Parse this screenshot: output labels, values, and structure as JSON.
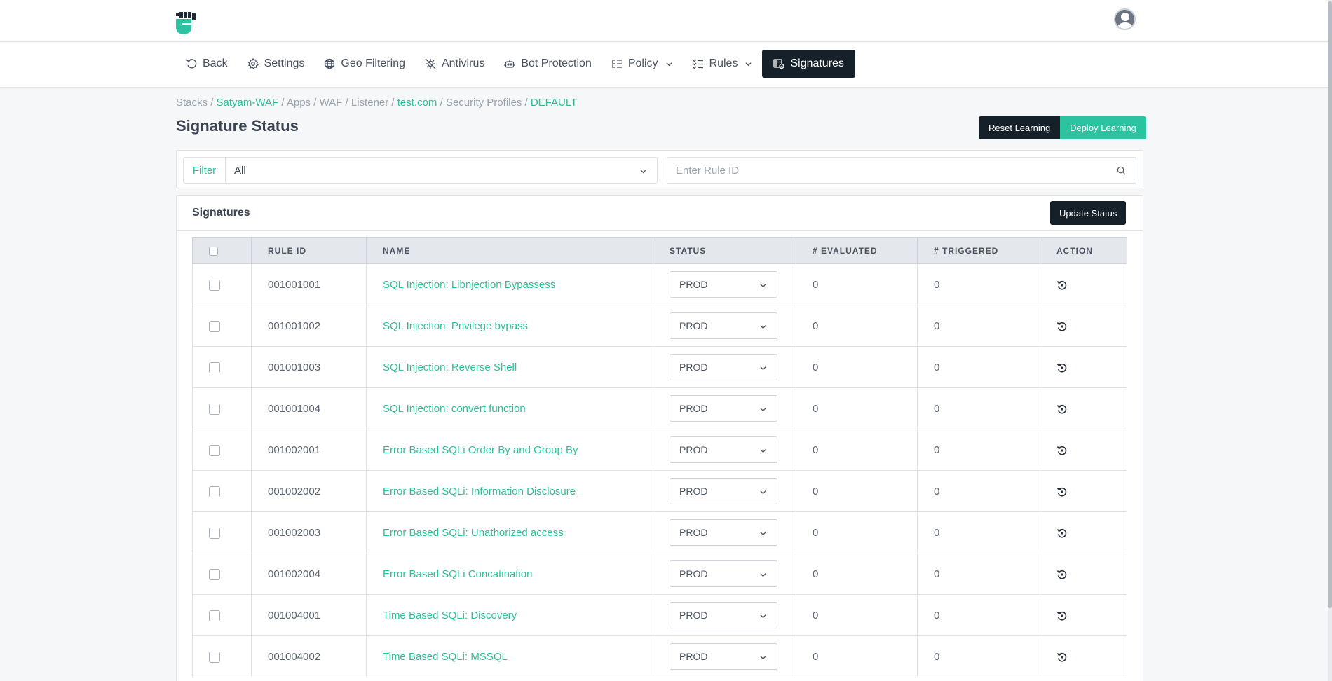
{
  "nav": {
    "items": [
      {
        "label": "Back",
        "icon": "back-icon"
      },
      {
        "label": "Settings",
        "icon": "gear-icon"
      },
      {
        "label": "Geo Filtering",
        "icon": "globe-icon"
      },
      {
        "label": "Antivirus",
        "icon": "virus-icon"
      },
      {
        "label": "Bot Protection",
        "icon": "robot-icon"
      },
      {
        "label": "Policy",
        "icon": "policy-icon"
      },
      {
        "label": "Rules",
        "icon": "rules-icon"
      },
      {
        "label": "Signatures",
        "icon": "signatures-icon"
      }
    ],
    "active": "Signatures"
  },
  "breadcrumb": {
    "stacks": "Stacks",
    "stack_name": "Satyam-WAF",
    "apps": "Apps",
    "waf": "WAF",
    "listener": "Listener",
    "domain": "test.com",
    "profiles": "Security Profiles",
    "profile": "DEFAULT",
    "sep": "/"
  },
  "page": {
    "title": "Signature Status",
    "reset_label": "Reset Learning",
    "deploy_label": "Deploy Learning"
  },
  "filter": {
    "label": "Filter",
    "selected": "All",
    "rule_placeholder": "Enter Rule ID"
  },
  "signatures": {
    "title": "Signatures",
    "update_label": "Update Status",
    "columns": [
      "RULE ID",
      "NAME",
      "STATUS",
      "# EVALUATED",
      "# TRIGGERED",
      "ACTION"
    ],
    "rows": [
      {
        "rule_id": "001001001",
        "name": "SQL Injection: Libnjection Bypassess",
        "status": "PROD",
        "evaluated": "0",
        "triggered": "0"
      },
      {
        "rule_id": "001001002",
        "name": "SQL Injection: Privilege bypass",
        "status": "PROD",
        "evaluated": "0",
        "triggered": "0"
      },
      {
        "rule_id": "001001003",
        "name": "SQL Injection: Reverse Shell",
        "status": "PROD",
        "evaluated": "0",
        "triggered": "0"
      },
      {
        "rule_id": "001001004",
        "name": "SQL Injection: convert function",
        "status": "PROD",
        "evaluated": "0",
        "triggered": "0"
      },
      {
        "rule_id": "001002001",
        "name": "Error Based SQLi Order By and Group By",
        "status": "PROD",
        "evaluated": "0",
        "triggered": "0"
      },
      {
        "rule_id": "001002002",
        "name": "Error Based SQLi: Information Disclosure",
        "status": "PROD",
        "evaluated": "0",
        "triggered": "0"
      },
      {
        "rule_id": "001002003",
        "name": "Error Based SQLi: Unathorized access",
        "status": "PROD",
        "evaluated": "0",
        "triggered": "0"
      },
      {
        "rule_id": "001002004",
        "name": "Error Based SQLi Concatination",
        "status": "PROD",
        "evaluated": "0",
        "triggered": "0"
      },
      {
        "rule_id": "001004001",
        "name": "Time Based SQLi: Discovery",
        "status": "PROD",
        "evaluated": "0",
        "triggered": "0"
      },
      {
        "rule_id": "001004002",
        "name": "Time Based SQLi: MSSQL",
        "status": "PROD",
        "evaluated": "0",
        "triggered": "0"
      }
    ]
  },
  "colors": {
    "accent": "#2cbf97",
    "dark": "#152028",
    "teal_button": "#2cc4a0"
  }
}
